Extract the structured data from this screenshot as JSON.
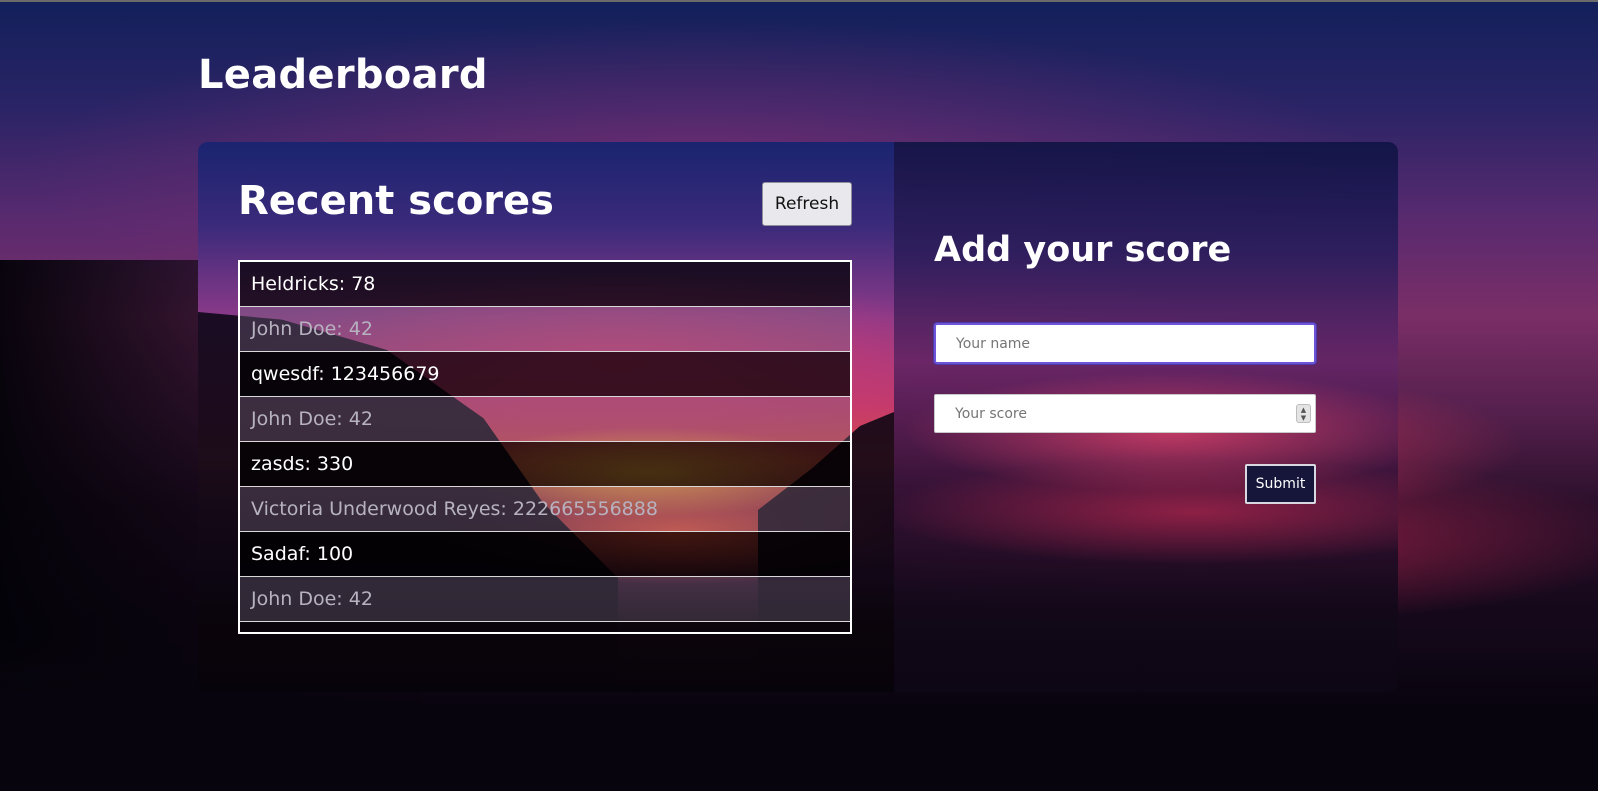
{
  "page": {
    "title": "Leaderboard"
  },
  "scores": {
    "title": "Recent scores",
    "refresh_label": "Refresh",
    "rows": [
      "Heldricks: 78",
      "John Doe: 42",
      "qwesdf: 123456679",
      "John Doe: 42",
      "zasds: 330",
      "Victoria Underwood Reyes: 222665556888",
      "Sadaf: 100",
      "John Doe: 42"
    ]
  },
  "form": {
    "title": "Add your score",
    "name_placeholder": "Your name",
    "name_value": "",
    "score_placeholder": "Your score",
    "score_value": "",
    "submit_label": "Submit"
  },
  "colors": {
    "focus_ring": "#6e54d8",
    "submit_bg": "#16163a"
  },
  "icons": {
    "stepper": "number-stepper-icon"
  }
}
